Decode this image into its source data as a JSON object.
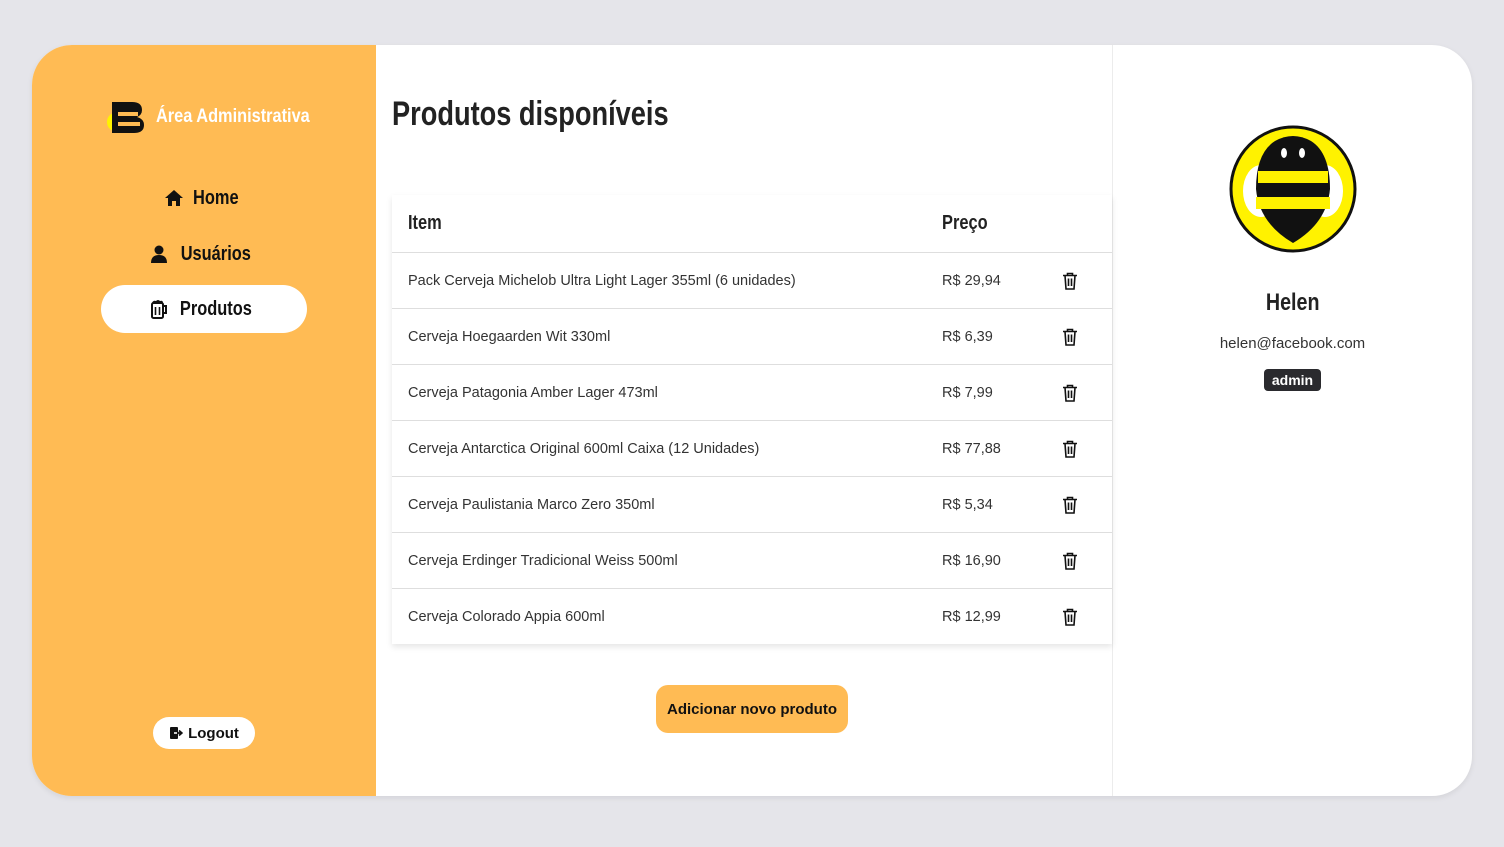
{
  "colors": {
    "accent": "#ffbb54",
    "background": "#e5e5ea",
    "badge": "#2a2a2e"
  },
  "brand": {
    "title": "Área Administrativa",
    "logo_icon": "bee-b-logo-icon"
  },
  "nav": {
    "items": [
      {
        "label": "Home",
        "icon": "home-icon",
        "active": false
      },
      {
        "label": "Usuários",
        "icon": "user-icon",
        "active": false
      },
      {
        "label": "Produtos",
        "icon": "beer-mug-icon",
        "active": true
      }
    ],
    "logout_label": "Logout"
  },
  "main": {
    "title": "Produtos disponíveis",
    "table": {
      "columns": [
        "Item",
        "Preço"
      ],
      "rows": [
        {
          "item": "Pack Cerveja Michelob Ultra Light Lager 355ml (6 unidades)",
          "price": "R$ 29,94"
        },
        {
          "item": "Cerveja Hoegaarden Wit 330ml",
          "price": "R$ 6,39"
        },
        {
          "item": "Cerveja Patagonia Amber Lager 473ml",
          "price": "R$ 7,99"
        },
        {
          "item": "Cerveja Antarctica Original 600ml Caixa (12 Unidades)",
          "price": "R$ 77,88"
        },
        {
          "item": "Cerveja Paulistania Marco Zero 350ml",
          "price": "R$ 5,34"
        },
        {
          "item": "Cerveja Erdinger Tradicional Weiss 500ml",
          "price": "R$ 16,90"
        },
        {
          "item": "Cerveja Colorado Appia 600ml",
          "price": "R$ 12,99"
        }
      ]
    },
    "add_button_label": "Adicionar novo produto"
  },
  "profile": {
    "name": "Helen",
    "email": "helen@facebook.com",
    "role": "admin",
    "avatar_icon": "bee-avatar-icon"
  }
}
